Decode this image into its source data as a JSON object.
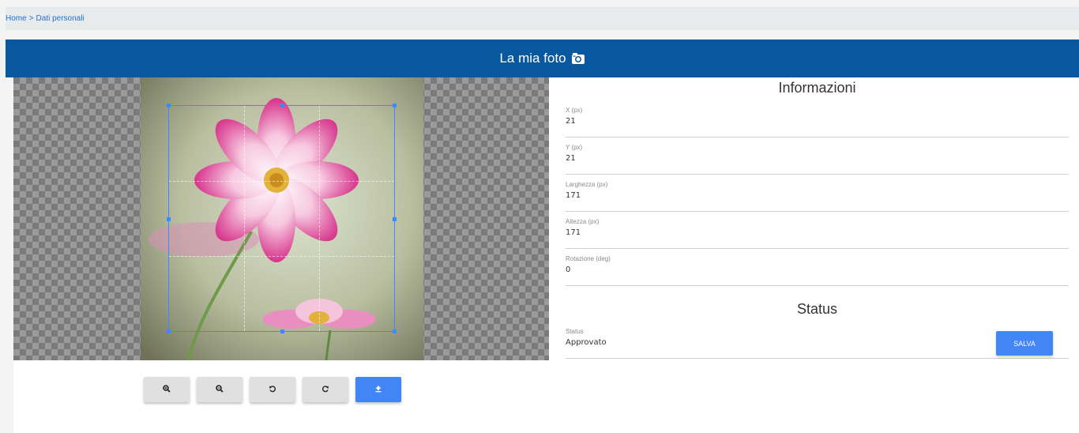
{
  "breadcrumb": {
    "home": "Home",
    "separator": ">",
    "current": "Dati personali"
  },
  "header": {
    "title": "La mia foto",
    "icon": "camera-icon"
  },
  "toolbar": {
    "buttons": [
      {
        "name": "zoom-in-button",
        "icon": "zoom-in-icon"
      },
      {
        "name": "zoom-out-button",
        "icon": "zoom-out-icon"
      },
      {
        "name": "rotate-left-button",
        "icon": "rotate-left-icon"
      },
      {
        "name": "rotate-right-button",
        "icon": "rotate-right-icon"
      },
      {
        "name": "upload-button",
        "icon": "upload-icon"
      }
    ]
  },
  "info": {
    "title": "Informazioni",
    "fields": [
      {
        "label": "X (px)",
        "value": "21"
      },
      {
        "label": "Y (px)",
        "value": "21"
      },
      {
        "label": "Larghezza (px)",
        "value": "171"
      },
      {
        "label": "Altezza (px)",
        "value": "171"
      },
      {
        "label": "Rotazione (deg)",
        "value": "0"
      }
    ]
  },
  "status": {
    "title": "Status",
    "field": {
      "label": "Status",
      "value": "Approvato"
    }
  },
  "actions": {
    "save_label": "SALVA"
  },
  "colors": {
    "header": "#07589e",
    "primary": "#4285f4",
    "link": "#1e6fd9",
    "crop": "#3b8bff"
  }
}
